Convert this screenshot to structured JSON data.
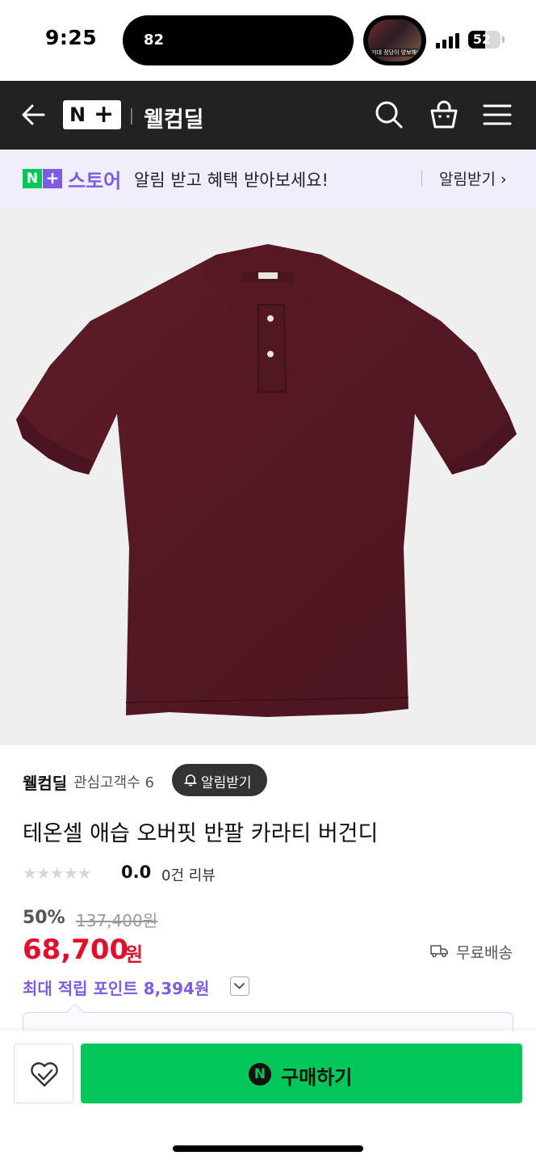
{
  "status_bar": {
    "time": "9:25",
    "island_text": "82",
    "live_caption": "거대 정당이 양보해라...",
    "battery": "52"
  },
  "header": {
    "logo_n": "N",
    "logo_plus": "+",
    "title": "웰컴딜"
  },
  "banner": {
    "badge_n": "N",
    "badge_plus": "+",
    "store_label": "스토어",
    "message": "알림 받고 혜택 받아보세요!",
    "cta": "알림받기 ›"
  },
  "product": {
    "seller": "웰컴딜",
    "seller_fans": "관심고객수 6",
    "alarm_button": "알림받기",
    "title": "테온셀 애습 오버핏 반팔 카라티 버건디",
    "stars": "★★★★★",
    "rating": "0.0",
    "reviews": "0건 리뷰",
    "discount": "50%",
    "original_price": "137,400원",
    "price": "68,700",
    "price_unit": "원",
    "shipping": "무료배송",
    "points": "최대 적립 포인트 8,394원",
    "image_color": "#5a1a24"
  },
  "bottom_bar": {
    "buy_badge": "N",
    "buy_label": "구매하기"
  },
  "colors": {
    "header_bg": "#222222",
    "naver_green": "#03c75a",
    "plus_purple": "#7e5be0",
    "price_red": "#e0102c"
  }
}
